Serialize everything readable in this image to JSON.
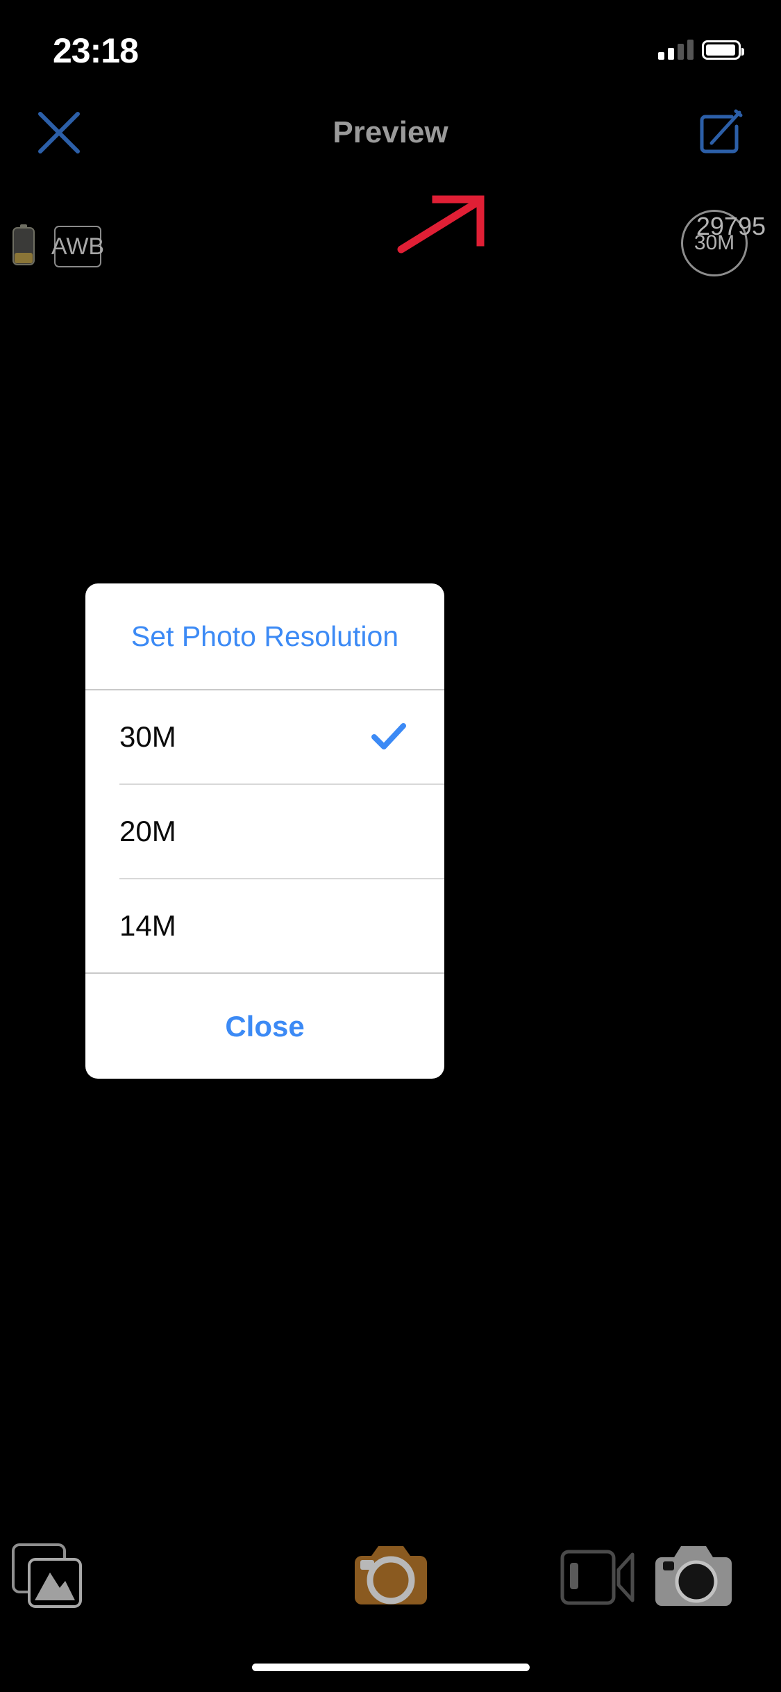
{
  "status_bar": {
    "time": "23:18",
    "signal_icon": "cellular-signal-icon",
    "signal_bars_filled": 2,
    "signal_bars_total": 4,
    "battery_icon": "battery-full-icon",
    "battery_level_percent": 100
  },
  "nav_bar": {
    "close_icon": "close-x-icon",
    "title": "Preview",
    "edit_icon": "compose-edit-icon",
    "accent_color": "#2c5fa8",
    "title_color": "#9a9a9a"
  },
  "camera_overlay": {
    "battery_indicator_icon": "battery-indicator-icon",
    "white_balance_label": "AWB",
    "resolution_badge": "30M",
    "shot_count": "29795",
    "annotation_arrow_icon": "red-arrow-icon",
    "annotation_color": "#e01f35"
  },
  "dialog": {
    "title": "Set Photo Resolution",
    "title_color": "#3c8af5",
    "options": [
      {
        "label": "30M",
        "selected": true,
        "check_icon": "checkmark-icon"
      },
      {
        "label": "20M",
        "selected": false,
        "check_icon": ""
      },
      {
        "label": "14M",
        "selected": false,
        "check_icon": ""
      }
    ],
    "close_label": "Close",
    "close_color": "#3c8af5",
    "background_color": "#ffffff"
  },
  "bottom_bar": {
    "gallery_icon": "photo-gallery-icon",
    "shutter_icon": "camera-shutter-icon",
    "shutter_color": "#8a5a20",
    "video_mode_icon": "video-camera-icon",
    "photo_mode_icon": "photo-camera-icon",
    "home_indicator_icon": "home-indicator-bar"
  }
}
